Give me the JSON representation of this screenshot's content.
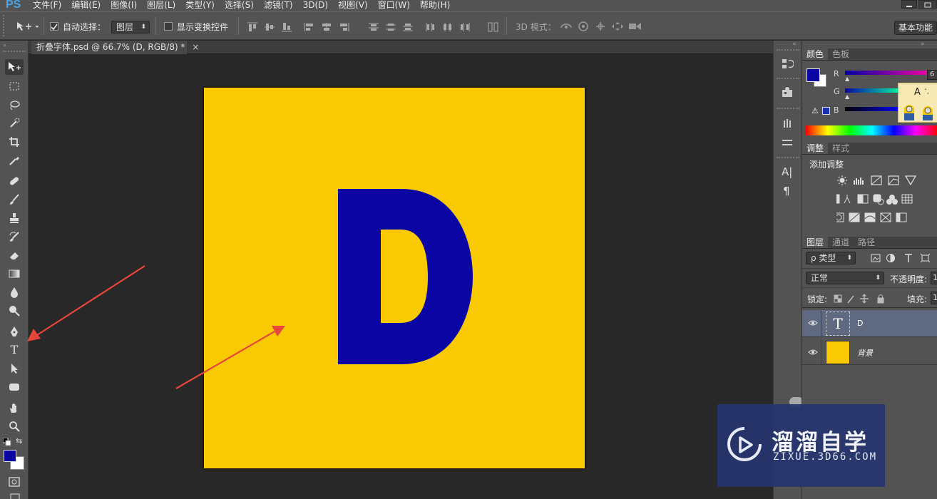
{
  "app": {
    "logo": "PS"
  },
  "menu": [
    "文件(F)",
    "编辑(E)",
    "图像(I)",
    "图层(L)",
    "类型(Y)",
    "选择(S)",
    "滤镜(T)",
    "3D(D)",
    "视图(V)",
    "窗口(W)",
    "帮助(H)"
  ],
  "options": {
    "auto_select_label": "自动选择：",
    "auto_select_checked": true,
    "auto_select_value": "图层",
    "show_transform_label": "显示变换控件",
    "mode_3d_label": "3D 模式：",
    "workspace_button": "基本功能"
  },
  "document": {
    "tab_title": "折叠字体.psd @ 66.7% (D, RGB/8) *",
    "close_glyph": "×",
    "canvas_color": "#f9c901",
    "letter": "D",
    "letter_color": "#0a05a3"
  },
  "tools": {
    "foreground_color": "#0a05a3",
    "background_color": "#ffffff"
  },
  "color_panel": {
    "tabs": [
      "颜色",
      "色板"
    ],
    "channels": [
      "R",
      "G",
      "B"
    ],
    "r_value": "6"
  },
  "adjust_panel": {
    "tabs": [
      "调整",
      "样式"
    ],
    "title": "添加调整"
  },
  "layers_panel": {
    "tabs": [
      "图层",
      "通道",
      "路径"
    ],
    "filter_label": "ρ 类型",
    "blend_mode": "正常",
    "opacity_label": "不透明度:",
    "opacity_value": "1",
    "lock_label": "锁定:",
    "fill_label": "填充:",
    "fill_value": "1",
    "layers": [
      {
        "name": "D",
        "type": "text",
        "thumb": "T",
        "selected": true
      },
      {
        "name": "背景",
        "type": "image",
        "selected": false
      }
    ]
  },
  "watermark": {
    "title": "溜溜自学",
    "url": "ZIXUE.3D66.COM"
  },
  "annotation_color": "#e8463c"
}
